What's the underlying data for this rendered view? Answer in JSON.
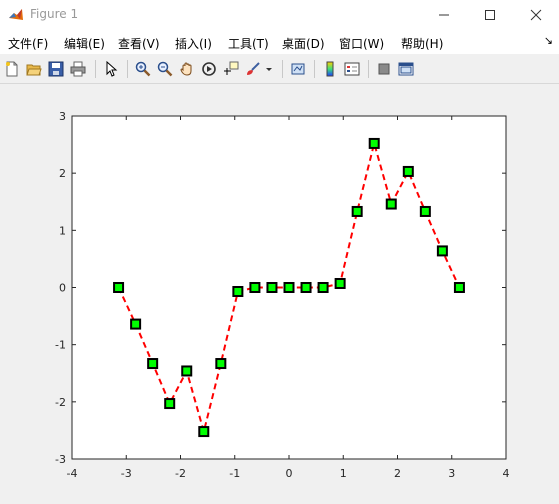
{
  "window": {
    "title": "Figure 1"
  },
  "menu": [
    {
      "label": "文件(F)"
    },
    {
      "label": "编辑(E)"
    },
    {
      "label": "查看(V)"
    },
    {
      "label": "插入(I)"
    },
    {
      "label": "工具(T)"
    },
    {
      "label": "桌面(D)"
    },
    {
      "label": "窗口(W)"
    },
    {
      "label": "帮助(H)"
    }
  ],
  "menu_overflow_glyph": "↘",
  "toolbar": [
    "new-figure-icon",
    "open-file-icon",
    "save-icon",
    "print-icon",
    "pointer-icon",
    "zoom-in-icon",
    "zoom-out-icon",
    "pan-icon",
    "rotate-3d-icon",
    "data-cursor-icon",
    "brush-icon",
    "link-plot-icon",
    "colorbar-icon",
    "legend-icon",
    "hide-plot-tools-icon",
    "show-plot-tools-icon"
  ],
  "colors": {
    "line": "#ff0000",
    "marker_face": "#00ff00",
    "marker_edge": "#000000",
    "axes_bg": "#ffffff"
  },
  "chart_data": {
    "type": "line",
    "title": "",
    "xlabel": "",
    "ylabel": "",
    "xlim": [
      -4,
      4
    ],
    "ylim": [
      -3,
      3
    ],
    "xticks": [
      "-4",
      "-3",
      "-2",
      "-1",
      "0",
      "1",
      "2",
      "3",
      "4"
    ],
    "yticks": [
      "3",
      "2",
      "1",
      "0",
      "-1",
      "-2",
      "-3"
    ],
    "grid": false,
    "line_style": "dashed",
    "marker": "square",
    "series": [
      {
        "x": [
          -3.1416,
          -2.8274,
          -2.5133,
          -2.1991,
          -1.885,
          -1.5708,
          -1.2566,
          -0.9425,
          -0.6283,
          -0.3142,
          0,
          0.3142,
          0.6283,
          0.9425,
          1.2566,
          1.5708,
          1.885,
          2.1991,
          2.5133,
          2.8274,
          3.1416
        ],
        "y": [
          0,
          -0.64,
          -1.33,
          -2.03,
          -1.46,
          -2.52,
          -1.33,
          -0.07,
          0,
          0,
          0,
          0,
          0,
          0.07,
          1.33,
          2.52,
          1.46,
          2.03,
          1.33,
          0.64,
          0
        ]
      }
    ]
  }
}
